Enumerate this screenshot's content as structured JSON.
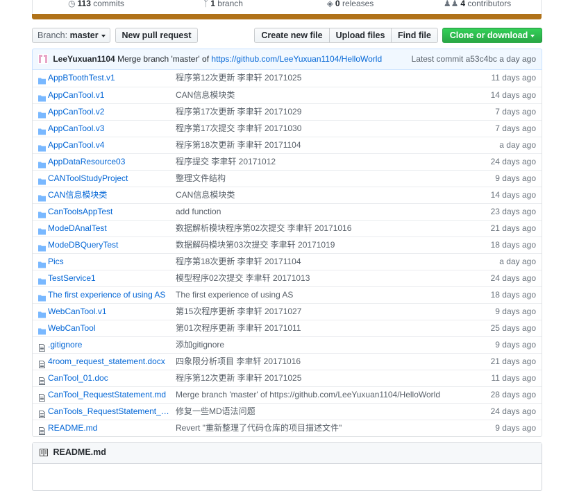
{
  "stats": {
    "commits": {
      "count": "113",
      "label": "commits"
    },
    "branch": {
      "count": "1",
      "label": "branch"
    },
    "releases": {
      "count": "0",
      "label": "releases"
    },
    "contributors": {
      "count": "4",
      "label": "contributors"
    }
  },
  "toolbar": {
    "branch_prefix": "Branch:",
    "branch_name": "master",
    "new_pull_request": "New pull request",
    "create_new_file": "Create new file",
    "upload_files": "Upload files",
    "find_file": "Find file",
    "clone_or_download": "Clone or download"
  },
  "latest_commit": {
    "author": "LeeYuxuan1104",
    "message_prefix": "Merge branch 'master' of",
    "message_link": "https://github.com/LeeYuxuan1104/HelloWorld",
    "label": "Latest commit",
    "sha": "a53c4bc",
    "time": "a day ago"
  },
  "files": [
    {
      "type": "dir",
      "name": "AppBToothTest.v1",
      "message": "程序第12次更新 李聿轩 20171025",
      "age": "11 days ago"
    },
    {
      "type": "dir",
      "name": "AppCanTool.v1",
      "message": "CAN信息模块类",
      "age": "14 days ago"
    },
    {
      "type": "dir",
      "name": "AppCanTool.v2",
      "message": "程序第17次更新 李聿轩 20171029",
      "age": "7 days ago"
    },
    {
      "type": "dir",
      "name": "AppCanTool.v3",
      "message": "程序第17次提交 李聿轩 20171030",
      "age": "7 days ago"
    },
    {
      "type": "dir",
      "name": "AppCanTool.v4",
      "message": "程序第18次更新 李聿轩 20171104",
      "age": "a day ago"
    },
    {
      "type": "dir",
      "name": "AppDataResource03",
      "message": "程序提交 李聿轩 20171012",
      "age": "24 days ago"
    },
    {
      "type": "dir",
      "name": "CANToolStudyProject",
      "message": "整理文件结构",
      "age": "9 days ago"
    },
    {
      "type": "dir",
      "name": "CAN信息模块类",
      "message": "CAN信息模块类",
      "age": "14 days ago"
    },
    {
      "type": "dir",
      "name": "CanToolsAppTest",
      "message": "add function",
      "age": "23 days ago"
    },
    {
      "type": "dir",
      "name": "ModeDAnalTest",
      "message": "数据解析模块程序第02次提交 李聿轩 20171016",
      "age": "21 days ago"
    },
    {
      "type": "dir",
      "name": "ModeDBQueryTest",
      "message": "数据解码模块第03次提交 李聿轩 20171019",
      "age": "18 days ago"
    },
    {
      "type": "dir",
      "name": "Pics",
      "message": "程序第18次更新 李聿轩 20171104",
      "age": "a day ago"
    },
    {
      "type": "dir",
      "name": "TestService1",
      "message": "模型程序02次提交 李聿轩 20171013",
      "age": "24 days ago"
    },
    {
      "type": "dir",
      "name": "The first experience of using AS",
      "message": "The first experience of using AS",
      "age": "18 days ago"
    },
    {
      "type": "dir",
      "name": "WebCanTool.v1",
      "message": "第15次程序更新 李聿轩 20171027",
      "age": "9 days ago"
    },
    {
      "type": "dir",
      "name": "WebCanTool",
      "message": "第01次程序更新 李聿轩 20171011",
      "age": "25 days ago"
    },
    {
      "type": "file",
      "name": ".gitignore",
      "message": "添加gitignore",
      "age": "9 days ago"
    },
    {
      "type": "file",
      "name": "4room_request_statement.docx",
      "message": "四象限分析项目 李聿轩 20171016",
      "age": "21 days ago"
    },
    {
      "type": "file",
      "name": "CanTool_01.doc",
      "message": "程序第12次更新 李聿轩 20171025",
      "age": "11 days ago"
    },
    {
      "type": "file",
      "name": "CanTool_RequestStatement.md",
      "message": "Merge branch 'master' of https://github.com/LeeYuxuan1104/HelloWorld",
      "age": "28 days ago"
    },
    {
      "type": "file",
      "name": "CanTools_RequestStatement_V…",
      "message": "修复一些MD语法问题",
      "age": "24 days ago"
    },
    {
      "type": "file",
      "name": "README.md",
      "message": "Revert \"重新整理了代码仓库的项目描述文件\"",
      "age": "9 days ago"
    }
  ],
  "readme": {
    "title": "README.md"
  },
  "colors": {
    "language_bar": "#b07219",
    "link": "#0366d6",
    "green_button": "#28a745",
    "folder": "#79b8ff"
  }
}
